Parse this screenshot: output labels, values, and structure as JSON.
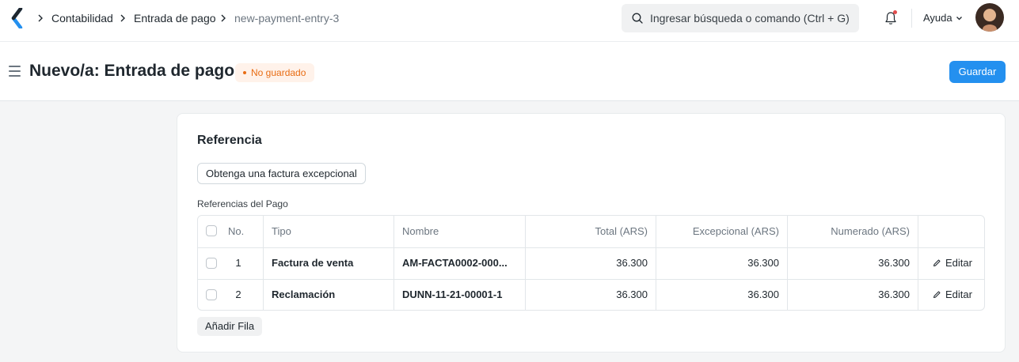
{
  "navbar": {
    "breadcrumbs": [
      "Contabilidad",
      "Entrada de pago",
      "new-payment-entry-3"
    ],
    "search_placeholder": "Ingresar búsqueda o comando (Ctrl + G)",
    "help_label": "Ayuda",
    "accent_color": "#2490ef"
  },
  "page": {
    "title": "Nuevo/a: Entrada de pago",
    "status_badge": "No guardado",
    "save_label": "Guardar"
  },
  "section": {
    "title": "Referencia",
    "get_invoice_button": "Obtenga una factura excepcional",
    "grid_label": "Referencias del Pago",
    "add_row_button": "Añadir Fila"
  },
  "table": {
    "columns": [
      "No.",
      "Tipo",
      "Nombre",
      "Total (ARS)",
      "Excepcional (ARS)",
      "Numerado (ARS)"
    ],
    "rows": [
      {
        "no": "1",
        "tipo": "Factura de venta",
        "nombre": "AM-FACTA0002-000...",
        "total": "36.300",
        "excepcional": "36.300",
        "numerado": "36.300",
        "edit": "Editar"
      },
      {
        "no": "2",
        "tipo": "Reclamación",
        "nombre": "DUNN-11-21-00001-1",
        "total": "36.300",
        "excepcional": "36.300",
        "numerado": "36.300",
        "edit": "Editar"
      }
    ]
  }
}
